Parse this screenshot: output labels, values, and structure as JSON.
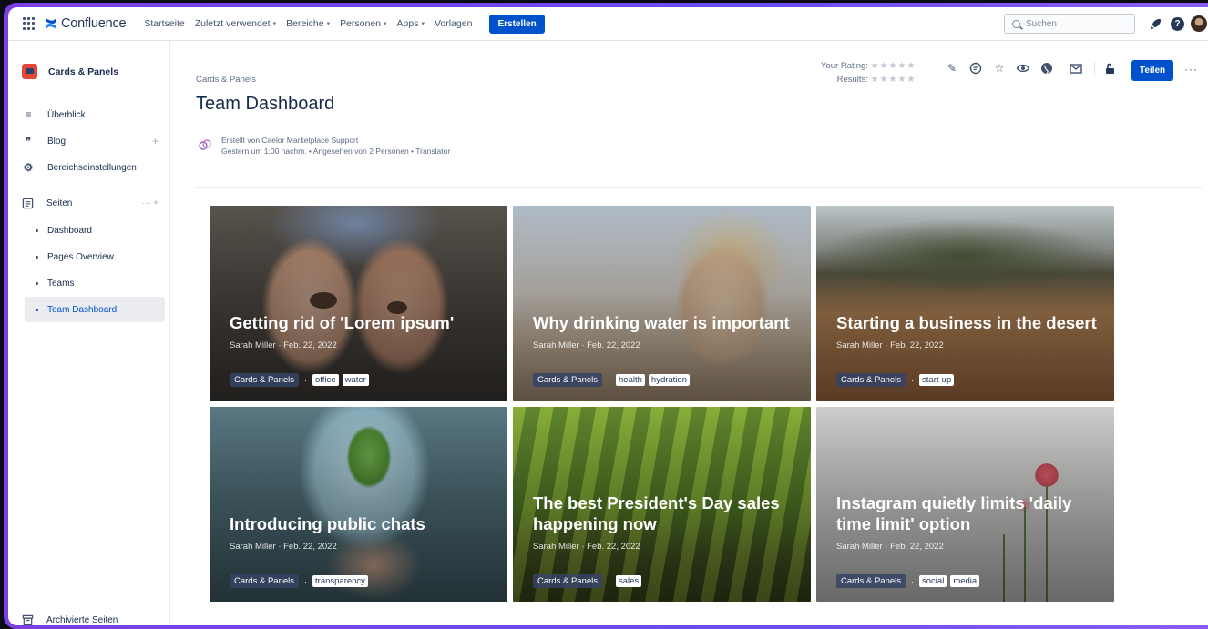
{
  "app": {
    "name": "Confluence",
    "accent": "#0052cc"
  },
  "topnav": {
    "items": [
      {
        "label": "Startseite",
        "has_menu": false
      },
      {
        "label": "Zuletzt verwendet",
        "has_menu": true
      },
      {
        "label": "Bereiche",
        "has_menu": true
      },
      {
        "label": "Personen",
        "has_menu": true
      },
      {
        "label": "Apps",
        "has_menu": true
      },
      {
        "label": "Vorlagen",
        "has_menu": false
      }
    ],
    "create_label": "Erstellen",
    "search_placeholder": "Suchen",
    "help_glyph": "?"
  },
  "sidebar": {
    "space_name": "Cards & Panels",
    "items": [
      {
        "label": "Überblick",
        "icon": "list-icon",
        "glyph": "≡"
      },
      {
        "label": "Blog",
        "icon": "quote-icon",
        "glyph": "❞",
        "extra": "+"
      },
      {
        "label": "Bereichseinstellungen",
        "icon": "gear-icon",
        "glyph": "⚙"
      }
    ],
    "pages_label": "Seiten",
    "pages_extra": "···   +",
    "pages": [
      {
        "label": "Dashboard",
        "active": false
      },
      {
        "label": "Pages Overview",
        "active": false
      },
      {
        "label": "Teams",
        "active": false
      },
      {
        "label": "Team Dashboard",
        "active": true
      }
    ],
    "archived_label": "Archivierte Seiten"
  },
  "page": {
    "breadcrumb": "Cards & Panels",
    "title": "Team Dashboard",
    "byline_line1": "Erstellt von Caelor Marketplace Support",
    "byline_line2": "Gestern um 1:00 nachm. •  Angesehen von 2 Personen •  Translator",
    "rating_label": "Your Rating:",
    "results_label": "Results:",
    "stars": "★★★★★",
    "share_label": "Teilen",
    "more_glyph": "···"
  },
  "cards": [
    {
      "title": "Getting rid of 'Lorem ipsum'",
      "meta": "Sarah Miller · Feb. 22, 2022",
      "space": "Cards & Panels",
      "tags": [
        "office",
        "water"
      ]
    },
    {
      "title": "Why drinking water is important",
      "meta": "Sarah Miller · Feb. 22, 2022",
      "space": "Cards & Panels",
      "tags": [
        "health",
        "hydration"
      ]
    },
    {
      "title": "Starting a business in the desert",
      "meta": "Sarah Miller · Feb. 22, 2022",
      "space": "Cards & Panels",
      "tags": [
        "start-up"
      ]
    },
    {
      "title": "Introducing public chats",
      "meta": "Sarah Miller · Feb. 22, 2022",
      "space": "Cards & Panels",
      "tags": [
        "transparency"
      ]
    },
    {
      "title": "The best President's Day sales happening now",
      "meta": "Sarah Miller · Feb. 22, 2022",
      "space": "Cards & Panels",
      "tags": [
        "sales"
      ]
    },
    {
      "title": "Instagram quietly limits 'daily time limit' option",
      "meta": "Sarah Miller · Feb. 22, 2022",
      "space": "Cards & Panels",
      "tags": [
        "social",
        "media"
      ]
    }
  ]
}
